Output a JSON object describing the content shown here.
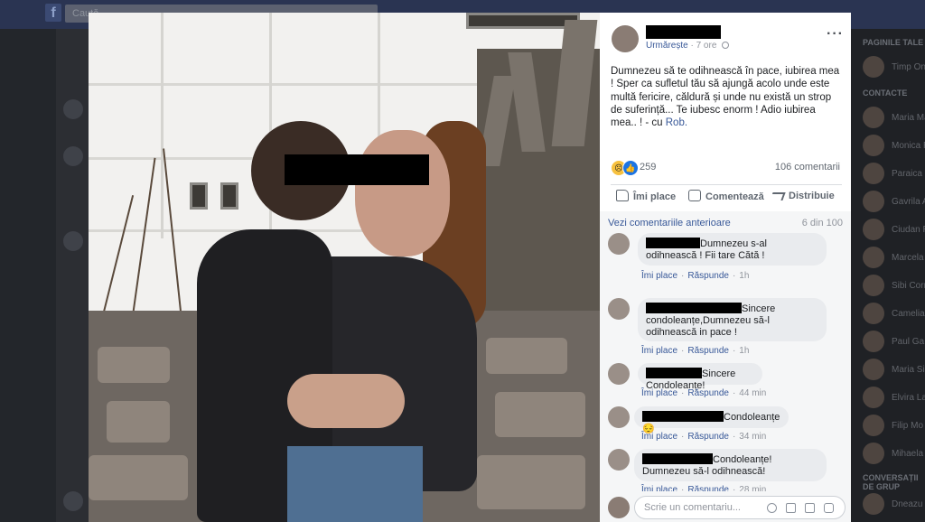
{
  "background": {
    "search_placeholder": "Caută",
    "right_header_pages": "PAGINILE TALE",
    "right_header_contacts": "CONTACTE",
    "right_header_groups": "CONVERSAȚII DE GRUP",
    "contacts": [
      "Timp Online",
      "Maria Ma",
      "Monica R",
      "Paraica",
      "Gavrila A",
      "Ciudan R",
      "Marcela",
      "Sibi Corr",
      "Camelia",
      "Paul Ga",
      "Maria Sil",
      "Elvira La",
      "Filip Mo",
      "Mihaela",
      "Dneazu"
    ]
  },
  "post": {
    "follow_label": "Urmărește",
    "dot": "·",
    "time": "7 ore",
    "text": "Dumnezeu să te odihnească în pace, iubirea mea ! Sper ca sufletul tău să ajungă acolo unde este multă fericire, căldură și unde nu există un strop de suferință... Te iubesc enorm ! Adio iubirea mea.. ! -",
    "tag_prefix": "cu",
    "tag_name": "Rob.",
    "reaction_count": "259",
    "comments_count": "106 comentarii",
    "like_label": "Îmi place",
    "comment_label": "Comentează",
    "share_label": "Distribuie",
    "colors": {
      "link": "#385898",
      "like_blue": "#1b74e4",
      "sad_yellow": "#f7c13f"
    }
  },
  "comments_section": {
    "previous_link": "Vezi comentariile anterioare",
    "count_label": "6 din 100",
    "like_action": "Îmi place",
    "reply_action": "Răspunde",
    "input_placeholder": "Scrie un comentariu...",
    "comments": [
      {
        "text": "Dumnezeu s-al odihnească ! Fii tare Cătă !",
        "time": "1h"
      },
      {
        "text": "Sincere condoleanțe,Dumnezeu să-l odihnească in pace !",
        "time": "1h"
      },
      {
        "text": "Sincere Condoleanțe!",
        "time": "44 min"
      },
      {
        "text": "Condoleanțe😔",
        "time": "34 min"
      },
      {
        "text": "Condoleanțe! Dumnezeu să-l odihnească!",
        "time": "28 min"
      }
    ]
  }
}
